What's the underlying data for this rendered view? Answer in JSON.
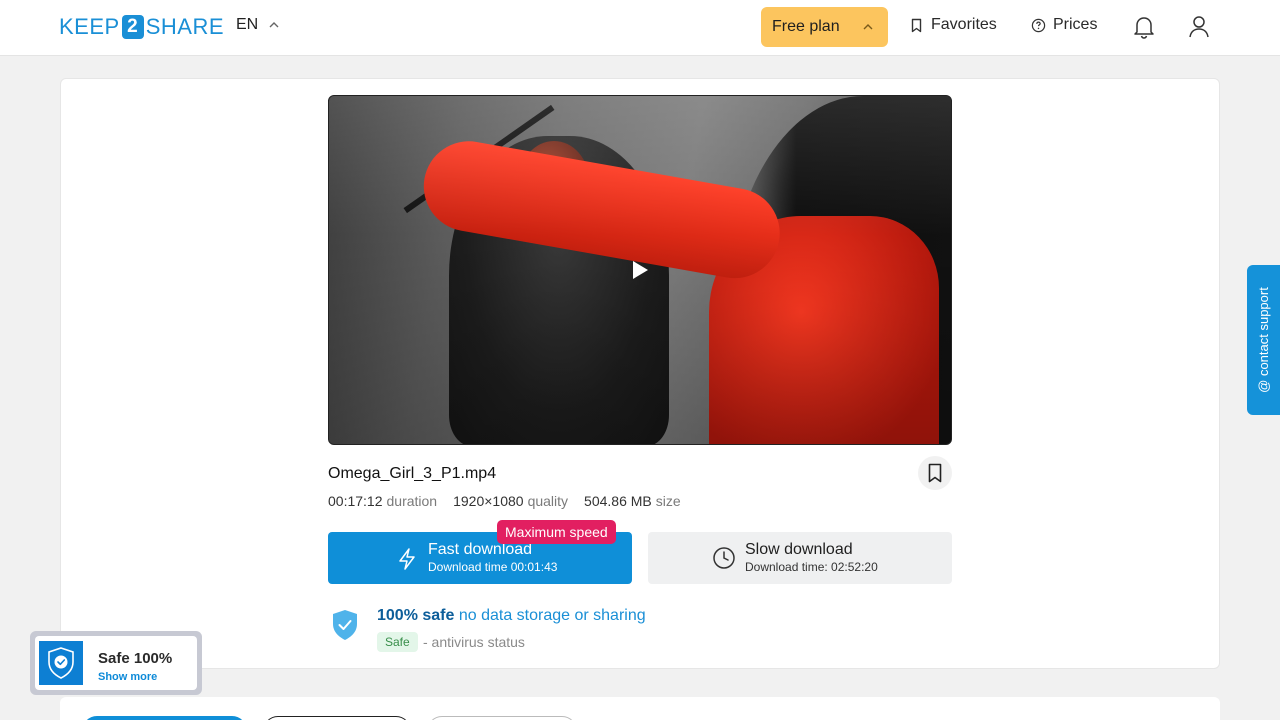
{
  "header": {
    "logo": {
      "left": "KEEP",
      "middle": "2",
      "right": "SHARE"
    },
    "language": "EN",
    "plan_label": "Free plan",
    "favorites_label": "Favorites",
    "prices_label": "Prices"
  },
  "file": {
    "name": "Omega_Girl_3_P1.mp4",
    "duration_value": "00:17:12",
    "duration_label": "duration",
    "quality_value": "1920×1080",
    "quality_label": "quality",
    "size_value": "504.86 MB",
    "size_label": "size"
  },
  "download": {
    "max_speed_badge": "Maximum speed",
    "fast_title": "Fast download",
    "fast_time": "Download time 00:01:43",
    "slow_title": "Slow download",
    "slow_time": "Download time: 02:52:20"
  },
  "safety": {
    "headline_bold": "100% safe",
    "headline_rest": "no data storage or sharing",
    "badge": "Safe",
    "status_text": "- antivirus status"
  },
  "support": {
    "label": "@ contact support"
  },
  "safe_widget": {
    "title": "Safe 100%",
    "link": "Show more"
  },
  "colors": {
    "accent": "#0f8fd8",
    "plan": "#fcc55e",
    "badge": "#e21f61"
  }
}
